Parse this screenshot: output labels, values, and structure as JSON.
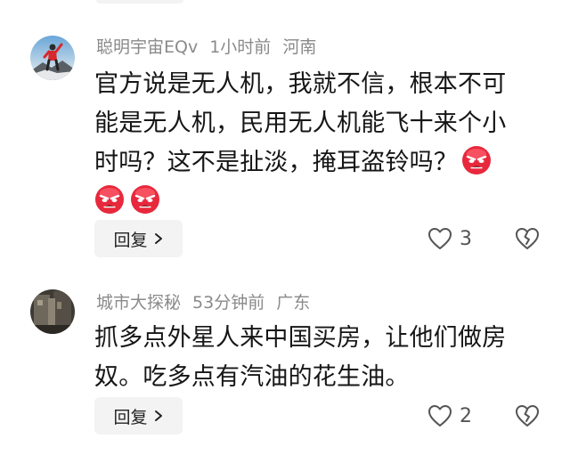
{
  "comments": [
    {
      "username": "聪明宇宙EQv",
      "time": "1小时前",
      "location": "河南",
      "text_line1": "官方说是无人机，我就不信，根本不可",
      "text_line2": "能是无人机，民用无人机能飞十来个小",
      "text_line3": "时吗？这不是扯淡，掩耳盗铃吗？",
      "emoji_icon": "angry-face-icon",
      "reply_label": "回复",
      "likes": "3"
    },
    {
      "username": "城市大探秘",
      "time": "53分钟前",
      "location": "广东",
      "text_line1": "抓多点外星人来中国买房，让他们做房",
      "text_line2": "奴。吃多点有汽油的花生油。",
      "reply_label": "回复",
      "likes": "2"
    }
  ],
  "colors": {
    "meta_text": "#8a8a8a",
    "body_text": "#161616",
    "reply_bg": "#f3f3f3",
    "emoji_red": "#e8283c"
  }
}
